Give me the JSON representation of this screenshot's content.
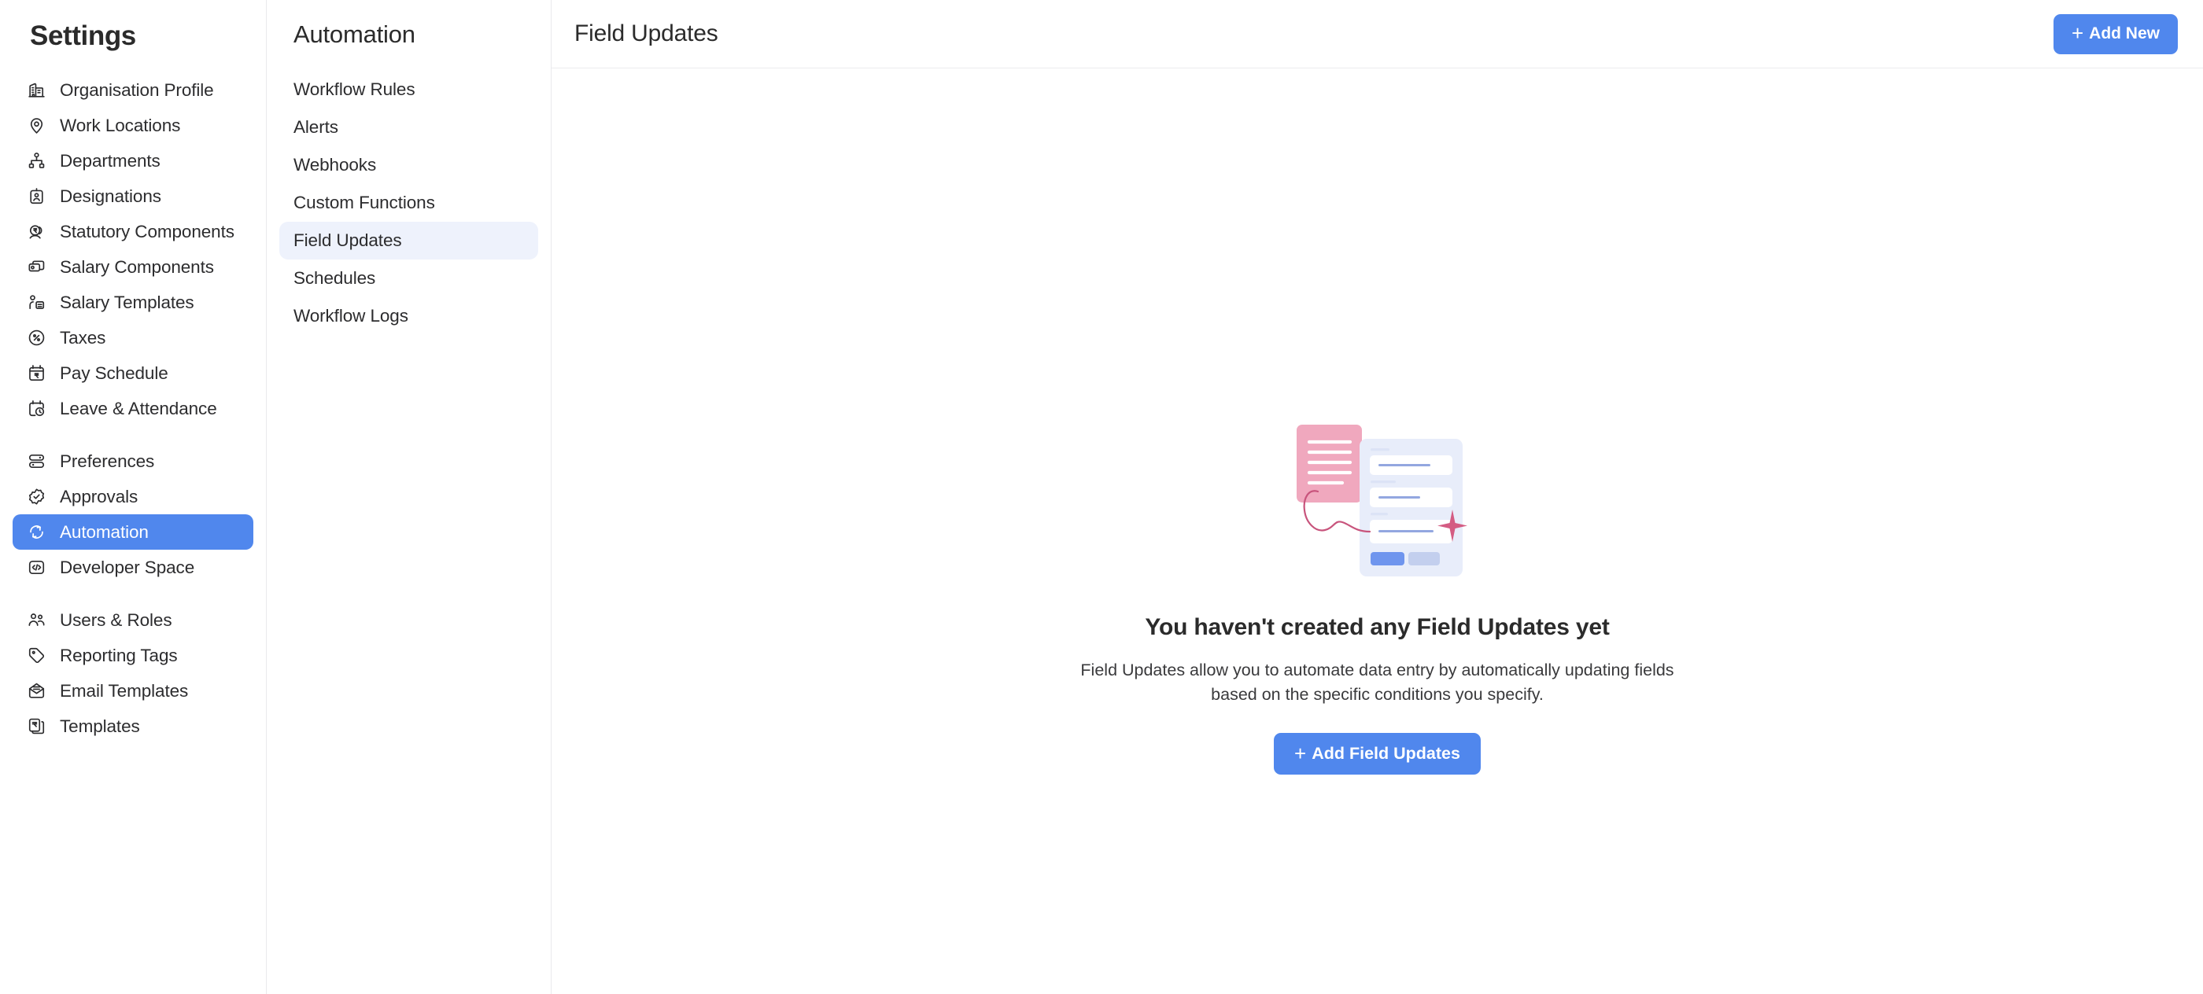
{
  "settings": {
    "title": "Settings",
    "items": [
      {
        "label": "Organisation Profile",
        "icon": "organisation-profile-icon",
        "active": false
      },
      {
        "label": "Work Locations",
        "icon": "location-pin-icon",
        "active": false
      },
      {
        "label": "Departments",
        "icon": "org-chart-icon",
        "active": false
      },
      {
        "label": "Designations",
        "icon": "id-badge-icon",
        "active": false
      },
      {
        "label": "Statutory Components",
        "icon": "rupee-person-icon",
        "active": false
      },
      {
        "label": "Salary Components",
        "icon": "money-stack-icon",
        "active": false
      },
      {
        "label": "Salary Templates",
        "icon": "person-document-icon",
        "active": false
      },
      {
        "label": "Taxes",
        "icon": "percent-circle-icon",
        "active": false
      },
      {
        "label": "Pay Schedule",
        "icon": "calendar-rupee-icon",
        "active": false
      },
      {
        "label": "Leave & Attendance",
        "icon": "calendar-clock-icon",
        "active": false
      },
      {
        "label": "Preferences",
        "icon": "sliders-icon",
        "active": false
      },
      {
        "label": "Approvals",
        "icon": "check-badge-icon",
        "active": false
      },
      {
        "label": "Automation",
        "icon": "refresh-cycle-icon",
        "active": true
      },
      {
        "label": "Developer Space",
        "icon": "code-brackets-icon",
        "active": false
      },
      {
        "label": "Users & Roles",
        "icon": "users-icon",
        "active": false
      },
      {
        "label": "Reporting Tags",
        "icon": "tag-icon",
        "active": false
      },
      {
        "label": "Email Templates",
        "icon": "envelope-icon",
        "active": false
      },
      {
        "label": "Templates",
        "icon": "rupee-documents-icon",
        "active": false
      }
    ]
  },
  "sub_nav": {
    "title": "Automation",
    "items": [
      {
        "label": "Workflow Rules",
        "active": false
      },
      {
        "label": "Alerts",
        "active": false
      },
      {
        "label": "Webhooks",
        "active": false
      },
      {
        "label": "Custom Functions",
        "active": false
      },
      {
        "label": "Field Updates",
        "active": true
      },
      {
        "label": "Schedules",
        "active": false
      },
      {
        "label": "Workflow Logs",
        "active": false
      }
    ]
  },
  "header": {
    "title": "Field Updates",
    "add_new_label": "Add New",
    "plus_glyph": "+"
  },
  "empty_state": {
    "title": "You haven't created any Field Updates yet",
    "description": "Field Updates allow you to automate data entry by automatically updating fields based on the specific conditions you specify.",
    "cta_label": "Add Field Updates",
    "plus_glyph": "+",
    "illustration": "empty-field-updates-illustration"
  },
  "colors": {
    "accent": "#5087ed",
    "active_sub_bg": "#eef2fc",
    "illustration_pink": "#f0a8be",
    "illustration_panel": "#e8edfa",
    "illustration_line_pink": "#c8547c",
    "text_primary": "#2b2b2b",
    "border": "#e9e9ec"
  }
}
